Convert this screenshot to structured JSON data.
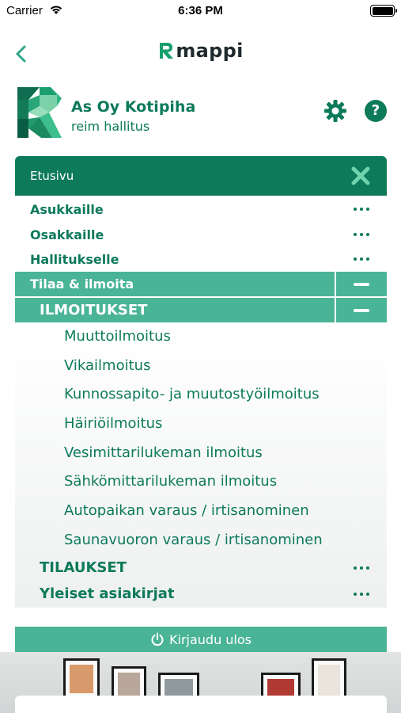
{
  "status_bar": {
    "carrier": "Carrier",
    "time": "6:36 PM"
  },
  "nav": {
    "brand_text": "mappi"
  },
  "header": {
    "org_name": "As Oy Kotipiha",
    "org_sub": "reim hallitus"
  },
  "menu": {
    "head_label": "Etusivu",
    "top_items": [
      {
        "label": "Asukkaille"
      },
      {
        "label": "Osakkaille"
      },
      {
        "label": "Hallitukselle"
      }
    ],
    "section": {
      "label": "Tilaa & ilmoita"
    },
    "subsection": {
      "label": "ILMOITUKSET"
    },
    "sub_items": [
      "Muuttoilmoitus",
      "Vikailmoitus",
      "Kunnossapito- ja muutostyöilmoitus",
      "Häiriöilmoitus",
      "Vesimittarilukeman ilmoitus",
      "Sähkömittarilukeman ilmoitus",
      "Autopaikan varaus / irtisanominen",
      "Saunavuoron varaus / irtisanominen"
    ],
    "bottom_items": [
      {
        "label": "TILAUKSET"
      },
      {
        "label": "Yleiset asiakirjat"
      }
    ]
  },
  "logout": {
    "label": "Kirjaudu ulos"
  },
  "colors": {
    "primary": "#0d7a5a",
    "accent": "#4ab496"
  },
  "icons": [
    "wifi-icon",
    "battery-icon",
    "back-chevron-icon",
    "mappi-logo-icon",
    "org-logo-icon",
    "gear-icon",
    "help-icon",
    "close-icon",
    "more-dots-icon",
    "minus-icon",
    "power-icon"
  ]
}
